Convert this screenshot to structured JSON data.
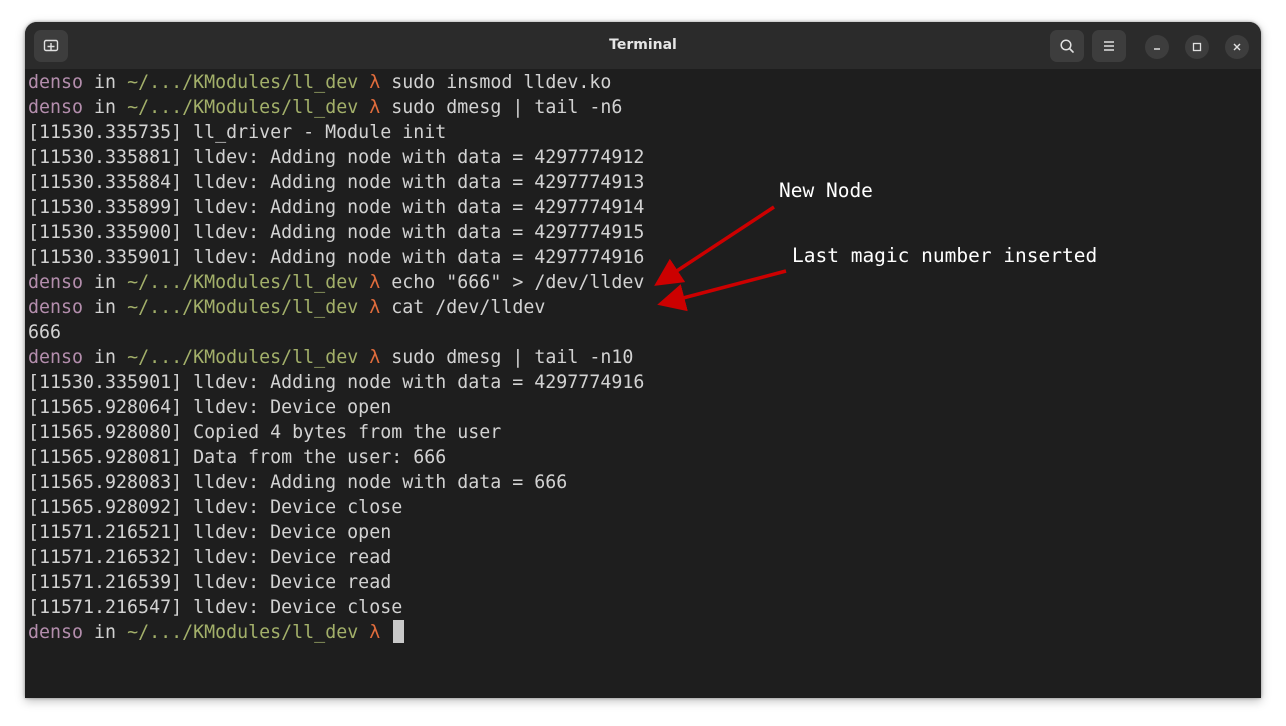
{
  "window": {
    "title": "Terminal"
  },
  "titlebar": {
    "new_tab_icon": "new-tab-icon",
    "search_icon": "search-icon",
    "menu_icon": "hamburger-menu-icon",
    "minimize_icon": "minimize-icon",
    "maximize_icon": "maximize-icon",
    "close_icon": "close-icon"
  },
  "prompt": {
    "user": "denso",
    "in": "in",
    "path": "~/.../KModules/ll_dev",
    "symbol": "λ"
  },
  "lines": [
    {
      "type": "prompt",
      "cmd": "sudo insmod lldev.ko"
    },
    {
      "type": "prompt",
      "cmd": "sudo dmesg | tail -n6"
    },
    {
      "type": "output",
      "text": "[11530.335735] ll_driver - Module init"
    },
    {
      "type": "output",
      "text": "[11530.335881] lldev: Adding node with data = 4297774912"
    },
    {
      "type": "output",
      "text": "[11530.335884] lldev: Adding node with data = 4297774913"
    },
    {
      "type": "output",
      "text": "[11530.335899] lldev: Adding node with data = 4297774914"
    },
    {
      "type": "output",
      "text": "[11530.335900] lldev: Adding node with data = 4297774915"
    },
    {
      "type": "output",
      "text": "[11530.335901] lldev: Adding node with data = 4297774916"
    },
    {
      "type": "prompt",
      "cmd": "echo \"666\" > /dev/lldev"
    },
    {
      "type": "prompt",
      "cmd": "cat /dev/lldev"
    },
    {
      "type": "output",
      "text": "666"
    },
    {
      "type": "prompt",
      "cmd": "sudo dmesg | tail -n10"
    },
    {
      "type": "output",
      "text": "[11530.335901] lldev: Adding node with data = 4297774916"
    },
    {
      "type": "output",
      "text": "[11565.928064] lldev: Device open"
    },
    {
      "type": "output",
      "text": "[11565.928080] Copied 4 bytes from the user"
    },
    {
      "type": "output",
      "text": "[11565.928081] Data from the user: 666"
    },
    {
      "type": "output",
      "text": "[11565.928083] lldev: Adding node with data = 666"
    },
    {
      "type": "output",
      "text": "[11565.928092] lldev: Device close"
    },
    {
      "type": "output",
      "text": "[11571.216521] lldev: Device open"
    },
    {
      "type": "output",
      "text": "[11571.216532] lldev: Device read"
    },
    {
      "type": "output",
      "text": "[11571.216539] lldev: Device read"
    },
    {
      "type": "output",
      "text": "[11571.216547] lldev: Device close"
    },
    {
      "type": "prompt",
      "cmd": "",
      "cursor": true
    }
  ],
  "annotations": {
    "new_node": "New Node",
    "last_magic": "Last magic number inserted",
    "arrow_color": "#cc0000"
  },
  "colors": {
    "background": "#1e1e1e",
    "titlebar": "#2b2b2b",
    "user": "#b48ead",
    "path": "#a3b06a",
    "lambda": "#e06c3c",
    "text": "#d2d2d2"
  }
}
